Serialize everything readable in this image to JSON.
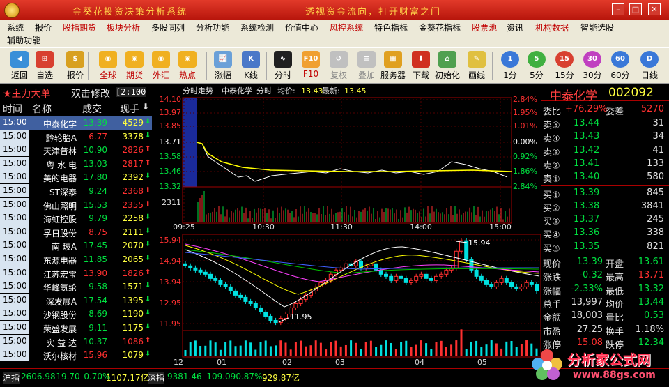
{
  "window": {
    "title": "金葵花投资决策分析系统",
    "slogan": "透视资金流向，打开财富之门"
  },
  "menu": [
    {
      "label": "系统",
      "hl": false
    },
    {
      "label": "报价",
      "hl": false
    },
    {
      "label": "股指期货",
      "hl": true
    },
    {
      "label": "板块分析",
      "hl": true
    },
    {
      "label": "多股同列",
      "hl": false
    },
    {
      "label": "分析功能",
      "hl": false
    },
    {
      "label": "系统检测",
      "hl": false
    },
    {
      "label": "价值中心",
      "hl": false
    },
    {
      "label": "风控系统",
      "hl": true
    },
    {
      "label": "特色指标",
      "hl": false
    },
    {
      "label": "金葵花指标",
      "hl": false
    },
    {
      "label": "股票池",
      "hl": true
    },
    {
      "label": "资讯",
      "hl": false
    },
    {
      "label": "机构数据",
      "hl": true
    },
    {
      "label": "智能选股",
      "hl": false
    },
    {
      "label": "辅助功能",
      "hl": false
    }
  ],
  "toolbar": [
    {
      "label": "返回",
      "icon": "back-icon",
      "color": "#3a8fd8",
      "style": ""
    },
    {
      "label": "自选",
      "icon": "basket-icon",
      "color": "#d84030",
      "style": ""
    },
    {
      "label": "报价",
      "icon": "dollar-icon",
      "color": "#d8a020",
      "style": ""
    },
    {
      "label": "全球",
      "icon": "globe-coin-icon",
      "color": "#f0b020",
      "style": "red"
    },
    {
      "label": "期货",
      "icon": "coin-icon",
      "color": "#f0b020",
      "style": "red"
    },
    {
      "label": "外汇",
      "icon": "exchange-icon",
      "color": "#f0b020",
      "style": "red"
    },
    {
      "label": "热点",
      "icon": "hot-icon",
      "color": "#f0b020",
      "style": "red"
    },
    {
      "label": "涨幅",
      "icon": "rise-chart-icon",
      "color": "#6aa0d8",
      "style": ""
    },
    {
      "label": "K线",
      "icon": "kline-icon",
      "color": "#4a78c8",
      "style": ""
    },
    {
      "label": "分时",
      "icon": "timeline-icon",
      "color": "#202020",
      "style": ""
    },
    {
      "label": "F10",
      "icon": "f10-icon",
      "color": "#f0a030",
      "style": "red"
    },
    {
      "label": "复权",
      "icon": "restore-icon",
      "color": "#c0c0c0",
      "style": "gray"
    },
    {
      "label": "叠加",
      "icon": "overlay-icon",
      "color": "#c0c0c0",
      "style": "gray"
    },
    {
      "label": "服务器",
      "icon": "server-icon",
      "color": "#e0a020",
      "style": ""
    },
    {
      "label": "下载",
      "icon": "download-icon",
      "color": "#d03020",
      "style": ""
    },
    {
      "label": "初始化",
      "icon": "home-icon",
      "color": "#50a050",
      "style": ""
    },
    {
      "label": "画线",
      "icon": "draw-line-icon",
      "color": "#e0c040",
      "style": ""
    },
    {
      "label": "1分",
      "icon": "period-1m-icon",
      "color": "#3a78d8",
      "style": ""
    },
    {
      "label": "5分",
      "icon": "period-5m-icon",
      "color": "#40b040",
      "style": ""
    },
    {
      "label": "15分",
      "icon": "period-15m-icon",
      "color": "#d84030",
      "style": ""
    },
    {
      "label": "30分",
      "icon": "period-30m-icon",
      "color": "#c040c0",
      "style": ""
    },
    {
      "label": "60分",
      "icon": "period-60m-icon",
      "color": "#3a78d8",
      "style": ""
    },
    {
      "label": "日线",
      "icon": "period-day-icon",
      "color": "#3a78d8",
      "style": ""
    }
  ],
  "toolbar_glyphs": [
    "◀",
    "⊞",
    "$",
    "◉",
    "◉",
    "◉",
    "◉",
    "📈",
    "K",
    "∿",
    "F10",
    "↺",
    "≡",
    "▦",
    "⬇",
    "⌂",
    "✎",
    "1",
    "5",
    "15",
    "30",
    "60",
    "D"
  ],
  "left": {
    "title": "★主力大单",
    "modify": "双击修改",
    "duration": "2:100",
    "headers": {
      "time": "时间",
      "name": "名称",
      "deal": "成交",
      "hand": "现手"
    },
    "rows": [
      {
        "time": "15:00",
        "name": "中泰化学",
        "price": "13.39",
        "vol": "4529",
        "up": true,
        "pc": "g"
      },
      {
        "time": "15:00",
        "name": "黔轮胎A",
        "price": "6.77",
        "vol": "3378",
        "up": true,
        "pc": "r"
      },
      {
        "time": "15:00",
        "name": "天津普林",
        "price": "10.90",
        "vol": "2826",
        "up": false,
        "pc": "g"
      },
      {
        "time": "15:00",
        "name": "粤 水 电",
        "price": "13.03",
        "vol": "2817",
        "up": false,
        "pc": "g"
      },
      {
        "time": "15:00",
        "name": "美的电器",
        "price": "17.80",
        "vol": "2392",
        "up": true,
        "pc": "g"
      },
      {
        "time": "15:00",
        "name": "ST深泰",
        "price": "9.24",
        "vol": "2368",
        "up": false,
        "pc": "g"
      },
      {
        "time": "15:00",
        "name": "佛山照明",
        "price": "15.53",
        "vol": "2355",
        "up": false,
        "pc": "g"
      },
      {
        "time": "15:00",
        "name": "海虹控股",
        "price": "9.79",
        "vol": "2258",
        "up": true,
        "pc": "g"
      },
      {
        "time": "15:00",
        "name": "孚日股份",
        "price": "8.75",
        "vol": "2111",
        "up": true,
        "pc": "r"
      },
      {
        "time": "15:00",
        "name": "南 玻A",
        "price": "17.45",
        "vol": "2070",
        "up": true,
        "pc": "g"
      },
      {
        "time": "15:00",
        "name": "东源电器",
        "price": "11.85",
        "vol": "2065",
        "up": true,
        "pc": "g"
      },
      {
        "time": "15:00",
        "name": "江苏宏宝",
        "price": "13.90",
        "vol": "1826",
        "up": false,
        "pc": "r"
      },
      {
        "time": "15:00",
        "name": "华峰氨纶",
        "price": "9.58",
        "vol": "1571",
        "up": true,
        "pc": "g"
      },
      {
        "time": "15:00",
        "name": "深发展A",
        "price": "17.54",
        "vol": "1395",
        "up": true,
        "pc": "g"
      },
      {
        "time": "15:00",
        "name": "沙钢股份",
        "price": "8.69",
        "vol": "1190",
        "up": true,
        "pc": "g"
      },
      {
        "time": "15:00",
        "name": "荣盛发展",
        "price": "9.11",
        "vol": "1175",
        "up": true,
        "pc": "g"
      },
      {
        "time": "15:00",
        "name": "实 益 达",
        "price": "10.37",
        "vol": "1086",
        "up": false,
        "pc": "g"
      },
      {
        "time": "15:00",
        "name": "沃尔核材",
        "price": "15.96",
        "vol": "1079",
        "up": true,
        "pc": "r"
      }
    ]
  },
  "intraday": {
    "title": "分时走势",
    "stock": "中泰化学",
    "label_ft": "分时",
    "avg_label": "均价:",
    "avg": "13.43",
    "last_label": "最新:",
    "last": "13.45",
    "y_left": [
      "14.10",
      "13.97",
      "13.85",
      "13.71",
      "13.58",
      "13.46",
      "13.32"
    ],
    "y_right": [
      "2.84%",
      "1.95%",
      "1.01%",
      "0.00%",
      "0.92%",
      "1.86%",
      "2.84%"
    ],
    "vol_label": "2311",
    "times": [
      "09:25",
      "10:30",
      "11:30",
      "14:00",
      "15:00"
    ]
  },
  "kline": {
    "y": [
      "15.94",
      "14.94",
      "13.94",
      "12.95",
      "11.95"
    ],
    "high": "15.94",
    "low": "11.95",
    "months": [
      "12",
      "01",
      "02",
      "03",
      "04",
      "05"
    ]
  },
  "quote": {
    "name": "中泰化学",
    "code": "002092",
    "weibi": {
      "label": "委比",
      "value": "+76.29%",
      "wc": "委差",
      "wv": "5270"
    },
    "sells": [
      {
        "l": "卖⑤",
        "p": "13.44",
        "v": "31"
      },
      {
        "l": "卖④",
        "p": "13.43",
        "v": "34"
      },
      {
        "l": "卖③",
        "p": "13.42",
        "v": "41"
      },
      {
        "l": "卖②",
        "p": "13.41",
        "v": "133"
      },
      {
        "l": "卖①",
        "p": "13.40",
        "v": "580"
      }
    ],
    "buys": [
      {
        "l": "买①",
        "p": "13.39",
        "v": "845"
      },
      {
        "l": "买②",
        "p": "13.38",
        "v": "3841"
      },
      {
        "l": "买③",
        "p": "13.37",
        "v": "245"
      },
      {
        "l": "买④",
        "p": "13.36",
        "v": "338"
      },
      {
        "l": "买⑤",
        "p": "13.35",
        "v": "821"
      }
    ],
    "stats": [
      {
        "l1": "现价",
        "v1": "13.39",
        "c1": "#00e040",
        "l2": "开盘",
        "v2": "13.61",
        "c2": "#00e040"
      },
      {
        "l1": "涨跌",
        "v1": "-0.32",
        "c1": "#00e040",
        "l2": "最高",
        "v2": "13.71",
        "c2": "#ff3030"
      },
      {
        "l1": "涨幅",
        "v1": "-2.33%",
        "c1": "#00e040",
        "l2": "最低",
        "v2": "13.32",
        "c2": "#00e040"
      },
      {
        "l1": "总手",
        "v1": "13,997",
        "c1": "#e0e0e0",
        "l2": "均价",
        "v2": "13.44",
        "c2": "#00e040"
      },
      {
        "l1": "金额",
        "v1": "18,003",
        "c1": "#e0e0e0",
        "l2": "量比",
        "v2": "0.53",
        "c2": "#00e040"
      },
      {
        "l1": "市盈",
        "v1": "27.25",
        "c1": "#e0e0e0",
        "l2": "换手",
        "v2": "1.18%",
        "c2": "#e0e0e0"
      },
      {
        "l1": "涨停",
        "v1": "15.08",
        "c1": "#ff3030",
        "l2": "跌停",
        "v2": "12.34",
        "c2": "#00e040"
      }
    ]
  },
  "status": {
    "sh_label": "沪指",
    "sh_val": "2606.98",
    "sh_chg": "-19.70",
    "sh_pct": "-0.70%",
    "sh_amt": "1107.17亿",
    "sz_label": "深指",
    "sz_val": "9381.46",
    "sz_chg": "-109.09",
    "sz_pct": "-0.87%",
    "sz_amt": "929.87亿"
  },
  "watermark": {
    "name": "分析家公式网",
    "url": "www.88gs.com"
  },
  "colors": {
    "up": "#ff3030",
    "down": "#00e040",
    "axis": "#a00000",
    "yellow": "#ffff00"
  }
}
